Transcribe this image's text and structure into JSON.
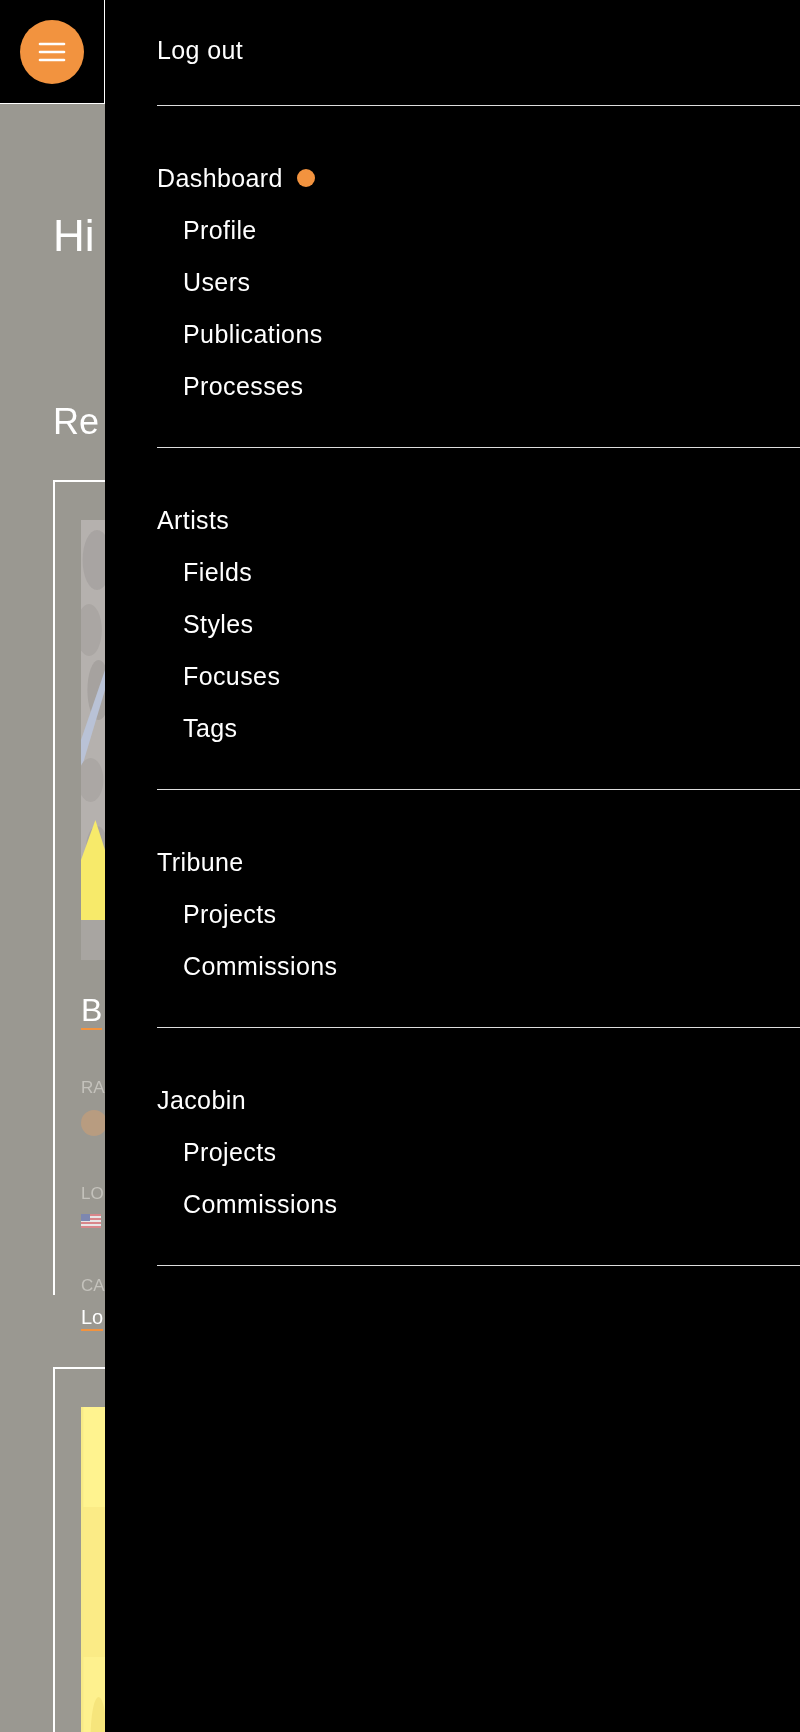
{
  "page": {
    "greeting": "Hi",
    "section_heading": "Re",
    "cards": [
      {
        "kind": "detailed",
        "title": "B",
        "fields": [
          {
            "kind": "avatar",
            "label": "RA"
          },
          {
            "kind": "flag",
            "label": "LO"
          },
          {
            "kind": "link",
            "label": "CA",
            "value": "Lo"
          }
        ]
      },
      {
        "kind": "picture_only"
      }
    ]
  },
  "drawer": {
    "logout": "Log out",
    "sections": [
      {
        "title": "Dashboard",
        "notification": true,
        "items": [
          "Profile",
          "Users",
          "Publications",
          "Processes"
        ]
      },
      {
        "title": "Artists",
        "notification": false,
        "items": [
          "Fields",
          "Styles",
          "Focuses",
          "Tags"
        ]
      },
      {
        "title": "Tribune",
        "notification": false,
        "items": [
          "Projects",
          "Commissions"
        ]
      },
      {
        "title": "Jacobin",
        "notification": false,
        "items": [
          "Projects",
          "Commissions"
        ]
      }
    ]
  }
}
